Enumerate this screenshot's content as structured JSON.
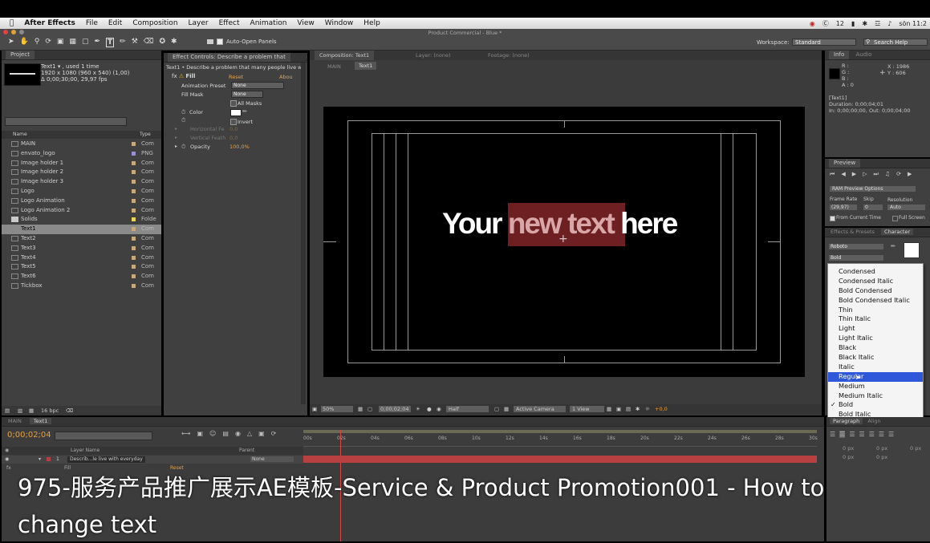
{
  "menubar": {
    "app": "After Effects",
    "items": [
      "File",
      "Edit",
      "Composition",
      "Layer",
      "Effect",
      "Animation",
      "View",
      "Window",
      "Help"
    ],
    "status": [
      "12",
      "sön 11:2"
    ]
  },
  "window_title": "Product Commercial - Blue *",
  "toolbar": {
    "auto_open": "Auto-Open Panels",
    "workspace_label": "Workspace:",
    "workspace_value": "Standard",
    "search_help": "Search Help"
  },
  "project": {
    "tab": "Project",
    "item_name": "Text1 ▾ , used 1 time",
    "item_size": "1920 x 1080  (960 x 540) (1,00)",
    "item_duration": "Δ 0;00;30;00, 29,97 fps",
    "col_name": "Name",
    "col_type": "Type",
    "items": [
      {
        "name": "MAIN",
        "type": "Com",
        "swatch": "#c9a87a"
      },
      {
        "name": "envato_logo",
        "type": "PNG",
        "swatch": "#9a8fd0"
      },
      {
        "name": "Image holder 1",
        "type": "Com",
        "swatch": "#c9a87a"
      },
      {
        "name": "Image holder 2",
        "type": "Com",
        "swatch": "#c9a87a"
      },
      {
        "name": "Image holder 3",
        "type": "Com",
        "swatch": "#c9a87a"
      },
      {
        "name": "Logo",
        "type": "Com",
        "swatch": "#c9a87a"
      },
      {
        "name": "Logo Animation",
        "type": "Com",
        "swatch": "#c9a87a"
      },
      {
        "name": "Logo Animation 2",
        "type": "Com",
        "swatch": "#c9a87a"
      },
      {
        "name": "Solids",
        "type": "Folde",
        "swatch": "#e8d55a"
      },
      {
        "name": "Text1",
        "type": "Com",
        "swatch": "#c9a87a"
      },
      {
        "name": "Text2",
        "type": "Com",
        "swatch": "#c9a87a"
      },
      {
        "name": "Text3",
        "type": "Com",
        "swatch": "#c9a87a"
      },
      {
        "name": "Text4",
        "type": "Com",
        "swatch": "#c9a87a"
      },
      {
        "name": "Text5",
        "type": "Com",
        "swatch": "#c9a87a"
      },
      {
        "name": "Text6",
        "type": "Com",
        "swatch": "#c9a87a"
      },
      {
        "name": "Tickbox",
        "type": "Com",
        "swatch": "#c9a87a"
      }
    ],
    "bpc": "16 bpc"
  },
  "effect_controls": {
    "tab": "Effect Controls: Describe a problem that",
    "header": "Text1 • Describe a problem that many people live w",
    "fill": "Fill",
    "reset": "Reset",
    "about": "Abou",
    "animation_preset": "Animation Preset",
    "preset_value": "None",
    "fill_mask": "Fill Mask",
    "fill_mask_value": "None",
    "all_masks": "All Masks",
    "color": "Color",
    "invert": "Invert",
    "h_feather": "Horizontal Fe",
    "h_feather_val": "0,0",
    "v_feather": "Vertical Feath",
    "v_feather_val": "0,0",
    "opacity": "Opacity",
    "opacity_val": "100,0%"
  },
  "composition": {
    "tab": "Composition: Text1",
    "layer_tab": "Layer: (none)",
    "footage_tab": "Footage: (none)",
    "crumb_main": "MAIN",
    "crumb_text1": "Text1",
    "text_your": "Your",
    "text_new": "new text",
    "text_here": "here",
    "zoom": "50%",
    "timecode": "0;00;02;04",
    "resolution": "Half",
    "camera": "Active Camera",
    "view": "1 View",
    "exposure": "+0,0"
  },
  "info": {
    "tab_info": "Info",
    "tab_audio": "Audio",
    "r": "R :",
    "g": "G :",
    "b": "B :",
    "a": "A : 0",
    "x": "X : 1986",
    "y": "Y : 606",
    "layer": "[Text1]",
    "duration": "Duration: 0;00;04;01",
    "inout": "In: 0;00;00;00, Out: 0;00;04;00"
  },
  "preview": {
    "tab": "Preview",
    "ram": "RAM Preview Options",
    "frame_rate": "Frame Rate",
    "skip": "Skip",
    "resolution": "Resolution",
    "fr_val": "(29,97)",
    "skip_val": "0",
    "res_val": "Auto",
    "from_current": "From Current Time",
    "full_screen": "Full Screen"
  },
  "character": {
    "tab_effects": "Effects & Presets",
    "tab_character": "Character",
    "font": "Roboto",
    "style": "Bold",
    "styles": [
      "Condensed",
      "Condensed Italic",
      "Bold Condensed",
      "Bold Condensed Italic",
      "Thin",
      "Thin Italic",
      "Light",
      "Light Italic",
      "Black",
      "Black Italic",
      "Italic",
      "Regular",
      "Medium",
      "Medium Italic",
      "Bold",
      "Bold Italic"
    ],
    "highlighted": "Regular",
    "checked": "Bold"
  },
  "paragraph": {
    "tab": "Paragraph",
    "tab_align": "Align",
    "px1": "0 px",
    "px2": "0 px",
    "px3": "0 px",
    "px4": "0 px",
    "px5": "0 px"
  },
  "timeline": {
    "tab_main": "MAIN",
    "tab_text1": "Text1",
    "timecode": "0;00;02;04",
    "layer_name_col": "Layer Name",
    "parent_col": "Parent",
    "layer_num": "1",
    "layer_name": "Describ...le live with everyday",
    "parent_value": "None",
    "fill": "Fill",
    "reset": "Reset",
    "ticks": [
      "00s",
      "02s",
      "04s",
      "06s",
      "08s",
      "10s",
      "12s",
      "14s",
      "16s",
      "18s",
      "20s",
      "22s",
      "24s",
      "26s",
      "28s",
      "30s"
    ]
  },
  "caption": "975-服务产品推广展示AE模板-Service & Product Promotion001 - How to change text",
  "colors": {
    "accent_orange": "#e8a23c",
    "highlight_blue": "#2e57d9",
    "text_box_red": "#6e1f22",
    "layer_bar_red": "#b84040"
  }
}
